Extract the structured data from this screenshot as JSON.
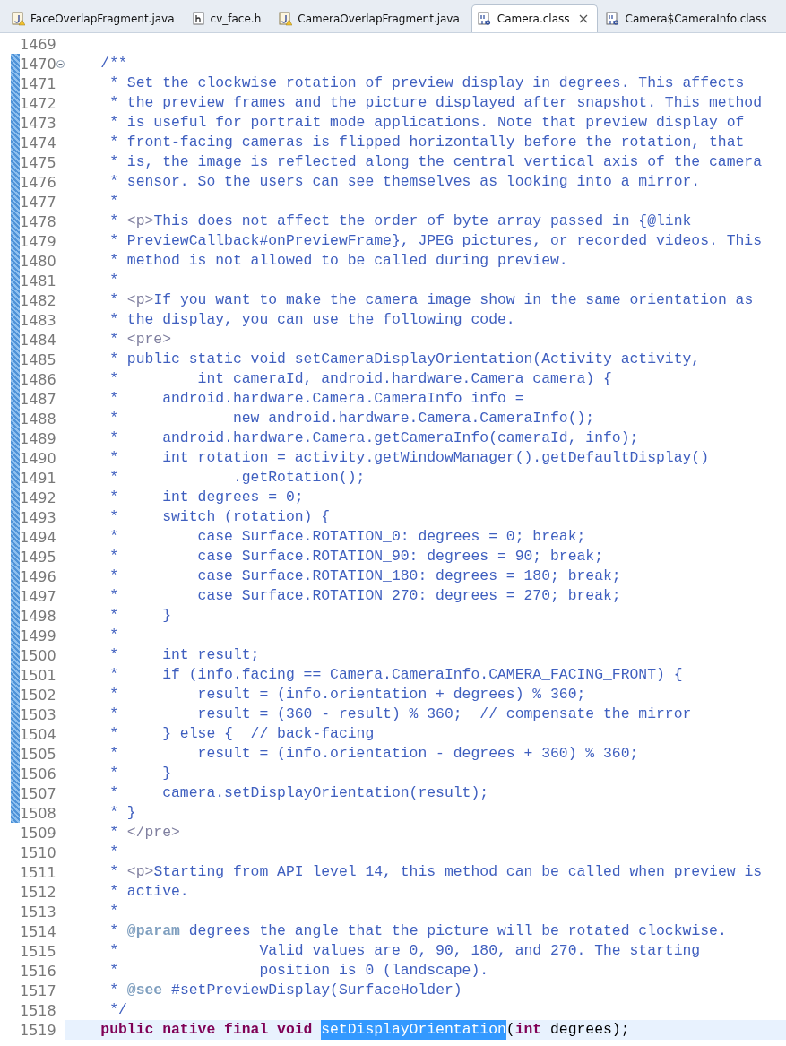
{
  "tabs": [
    {
      "label": "FaceOverlapFragment.java",
      "kind": "java",
      "selected": false
    },
    {
      "label": "cv_face.h",
      "kind": "header",
      "selected": false
    },
    {
      "label": "CameraOverlapFragment.java",
      "kind": "java",
      "selected": false
    },
    {
      "label": "Camera.class",
      "kind": "class",
      "selected": true
    },
    {
      "label": "Camera$CameraInfo.class",
      "kind": "class",
      "selected": false
    }
  ],
  "lines": [
    {
      "number": "1469",
      "marked": false,
      "fold": false,
      "current": false
    },
    {
      "number": "1470",
      "marked": true,
      "fold": true,
      "current": false,
      "segments": [
        {
          "kind": "comment",
          "text": "    /**"
        }
      ]
    },
    {
      "number": "1471",
      "marked": true,
      "fold": false,
      "current": false,
      "segments": [
        {
          "kind": "comment",
          "text": "     * Set the clockwise rotation of preview display in degrees. This affects"
        }
      ]
    },
    {
      "number": "1472",
      "marked": true,
      "fold": false,
      "current": false,
      "segments": [
        {
          "kind": "comment",
          "text": "     * the preview frames and the picture displayed after snapshot. This method"
        }
      ]
    },
    {
      "number": "1473",
      "marked": true,
      "fold": false,
      "current": false,
      "segments": [
        {
          "kind": "comment",
          "text": "     * is useful for portrait mode applications. Note that preview display of"
        }
      ]
    },
    {
      "number": "1474",
      "marked": true,
      "fold": false,
      "current": false,
      "segments": [
        {
          "kind": "comment",
          "text": "     * front-facing cameras is flipped horizontally before the rotation, that"
        }
      ]
    },
    {
      "number": "1475",
      "marked": true,
      "fold": false,
      "current": false,
      "segments": [
        {
          "kind": "comment",
          "text": "     * is, the image is reflected along the central vertical axis of the camera"
        }
      ]
    },
    {
      "number": "1476",
      "marked": true,
      "fold": false,
      "current": false,
      "segments": [
        {
          "kind": "comment",
          "text": "     * sensor. So the users can see themselves as looking into a mirror."
        }
      ]
    },
    {
      "number": "1477",
      "marked": true,
      "fold": false,
      "current": false,
      "segments": [
        {
          "kind": "comment",
          "text": "     *"
        }
      ]
    },
    {
      "number": "1478",
      "marked": true,
      "fold": false,
      "current": false,
      "segments": [
        {
          "kind": "comment",
          "text": "     * "
        },
        {
          "kind": "html",
          "text": "<p>"
        },
        {
          "kind": "comment",
          "text": "This does not affect the order of byte array passed in {@link"
        }
      ]
    },
    {
      "number": "1479",
      "marked": true,
      "fold": false,
      "current": false,
      "segments": [
        {
          "kind": "comment",
          "text": "     * PreviewCallback#onPreviewFrame}, JPEG pictures, or recorded videos. This"
        }
      ]
    },
    {
      "number": "1480",
      "marked": true,
      "fold": false,
      "current": false,
      "segments": [
        {
          "kind": "comment",
          "text": "     * method is not allowed to be called during preview."
        }
      ]
    },
    {
      "number": "1481",
      "marked": true,
      "fold": false,
      "current": false,
      "segments": [
        {
          "kind": "comment",
          "text": "     *"
        }
      ]
    },
    {
      "number": "1482",
      "marked": true,
      "fold": false,
      "current": false,
      "segments": [
        {
          "kind": "comment",
          "text": "     * "
        },
        {
          "kind": "html",
          "text": "<p>"
        },
        {
          "kind": "comment",
          "text": "If you want to make the camera image show in the same orientation as"
        }
      ]
    },
    {
      "number": "1483",
      "marked": true,
      "fold": false,
      "current": false,
      "segments": [
        {
          "kind": "comment",
          "text": "     * the display, you can use the following code."
        }
      ]
    },
    {
      "number": "1484",
      "marked": true,
      "fold": false,
      "current": false,
      "segments": [
        {
          "kind": "comment",
          "text": "     * "
        },
        {
          "kind": "html",
          "text": "<pre>"
        }
      ]
    },
    {
      "number": "1485",
      "marked": true,
      "fold": false,
      "current": false,
      "segments": [
        {
          "kind": "comment",
          "text": "     * public static void setCameraDisplayOrientation(Activity activity,"
        }
      ]
    },
    {
      "number": "1486",
      "marked": true,
      "fold": false,
      "current": false,
      "segments": [
        {
          "kind": "comment",
          "text": "     *         int cameraId, android.hardware.Camera camera) {"
        }
      ]
    },
    {
      "number": "1487",
      "marked": true,
      "fold": false,
      "current": false,
      "segments": [
        {
          "kind": "comment",
          "text": "     *     android.hardware.Camera.CameraInfo info ="
        }
      ]
    },
    {
      "number": "1488",
      "marked": true,
      "fold": false,
      "current": false,
      "segments": [
        {
          "kind": "comment",
          "text": "     *             new android.hardware.Camera.CameraInfo();"
        }
      ]
    },
    {
      "number": "1489",
      "marked": true,
      "fold": false,
      "current": false,
      "segments": [
        {
          "kind": "comment",
          "text": "     *     android.hardware.Camera.getCameraInfo(cameraId, info);"
        }
      ]
    },
    {
      "number": "1490",
      "marked": true,
      "fold": false,
      "current": false,
      "segments": [
        {
          "kind": "comment",
          "text": "     *     int rotation = activity.getWindowManager().getDefaultDisplay()"
        }
      ]
    },
    {
      "number": "1491",
      "marked": true,
      "fold": false,
      "current": false,
      "segments": [
        {
          "kind": "comment",
          "text": "     *             .getRotation();"
        }
      ]
    },
    {
      "number": "1492",
      "marked": true,
      "fold": false,
      "current": false,
      "segments": [
        {
          "kind": "comment",
          "text": "     *     int degrees = 0;"
        }
      ]
    },
    {
      "number": "1493",
      "marked": true,
      "fold": false,
      "current": false,
      "segments": [
        {
          "kind": "comment",
          "text": "     *     switch (rotation) {"
        }
      ]
    },
    {
      "number": "1494",
      "marked": true,
      "fold": false,
      "current": false,
      "segments": [
        {
          "kind": "comment",
          "text": "     *         case Surface.ROTATION_0: degrees = 0; break;"
        }
      ]
    },
    {
      "number": "1495",
      "marked": true,
      "fold": false,
      "current": false,
      "segments": [
        {
          "kind": "comment",
          "text": "     *         case Surface.ROTATION_90: degrees = 90; break;"
        }
      ]
    },
    {
      "number": "1496",
      "marked": true,
      "fold": false,
      "current": false,
      "segments": [
        {
          "kind": "comment",
          "text": "     *         case Surface.ROTATION_180: degrees = 180; break;"
        }
      ]
    },
    {
      "number": "1497",
      "marked": true,
      "fold": false,
      "current": false,
      "segments": [
        {
          "kind": "comment",
          "text": "     *         case Surface.ROTATION_270: degrees = 270; break;"
        }
      ]
    },
    {
      "number": "1498",
      "marked": true,
      "fold": false,
      "current": false,
      "segments": [
        {
          "kind": "comment",
          "text": "     *     }"
        }
      ]
    },
    {
      "number": "1499",
      "marked": true,
      "fold": false,
      "current": false,
      "segments": [
        {
          "kind": "comment",
          "text": "     *"
        }
      ]
    },
    {
      "number": "1500",
      "marked": true,
      "fold": false,
      "current": false,
      "segments": [
        {
          "kind": "comment",
          "text": "     *     int result;"
        }
      ]
    },
    {
      "number": "1501",
      "marked": true,
      "fold": false,
      "current": false,
      "segments": [
        {
          "kind": "comment",
          "text": "     *     if (info.facing == Camera.CameraInfo.CAMERA_FACING_FRONT) {"
        }
      ]
    },
    {
      "number": "1502",
      "marked": true,
      "fold": false,
      "current": false,
      "segments": [
        {
          "kind": "comment",
          "text": "     *         result = (info.orientation + degrees) % 360;"
        }
      ]
    },
    {
      "number": "1503",
      "marked": true,
      "fold": false,
      "current": false,
      "segments": [
        {
          "kind": "comment",
          "text": "     *         result = (360 - result) % 360;  // compensate the mirror"
        }
      ]
    },
    {
      "number": "1504",
      "marked": true,
      "fold": false,
      "current": false,
      "segments": [
        {
          "kind": "comment",
          "text": "     *     } else {  // back-facing"
        }
      ]
    },
    {
      "number": "1505",
      "marked": true,
      "fold": false,
      "current": false,
      "segments": [
        {
          "kind": "comment",
          "text": "     *         result = (info.orientation - degrees + 360) % 360;"
        }
      ]
    },
    {
      "number": "1506",
      "marked": true,
      "fold": false,
      "current": false,
      "segments": [
        {
          "kind": "comment",
          "text": "     *     }"
        }
      ]
    },
    {
      "number": "1507",
      "marked": true,
      "fold": false,
      "current": false,
      "segments": [
        {
          "kind": "comment",
          "text": "     *     camera.setDisplayOrientation(result);"
        }
      ]
    },
    {
      "number": "1508",
      "marked": true,
      "fold": false,
      "current": false,
      "segments": [
        {
          "kind": "comment",
          "text": "     * }"
        }
      ]
    },
    {
      "number": "1509",
      "marked": false,
      "fold": false,
      "current": false,
      "segments": [
        {
          "kind": "comment",
          "text": "     * "
        },
        {
          "kind": "html",
          "text": "</pre>"
        }
      ]
    },
    {
      "number": "1510",
      "marked": false,
      "fold": false,
      "current": false,
      "segments": [
        {
          "kind": "comment",
          "text": "     *"
        }
      ]
    },
    {
      "number": "1511",
      "marked": false,
      "fold": false,
      "current": false,
      "segments": [
        {
          "kind": "comment",
          "text": "     * "
        },
        {
          "kind": "html",
          "text": "<p>"
        },
        {
          "kind": "comment",
          "text": "Starting from API level 14, this method can be called when preview is"
        }
      ]
    },
    {
      "number": "1512",
      "marked": false,
      "fold": false,
      "current": false,
      "segments": [
        {
          "kind": "comment",
          "text": "     * active."
        }
      ]
    },
    {
      "number": "1513",
      "marked": false,
      "fold": false,
      "current": false,
      "segments": [
        {
          "kind": "comment",
          "text": "     *"
        }
      ]
    },
    {
      "number": "1514",
      "marked": false,
      "fold": false,
      "current": false,
      "segments": [
        {
          "kind": "comment",
          "text": "     * "
        },
        {
          "kind": "doctag",
          "text": "@param"
        },
        {
          "kind": "comment",
          "text": " degrees the angle that the picture will be rotated clockwise."
        }
      ]
    },
    {
      "number": "1515",
      "marked": false,
      "fold": false,
      "current": false,
      "segments": [
        {
          "kind": "comment",
          "text": "     *                Valid values are 0, 90, 180, and 270. The starting"
        }
      ]
    },
    {
      "number": "1516",
      "marked": false,
      "fold": false,
      "current": false,
      "segments": [
        {
          "kind": "comment",
          "text": "     *                position is 0 (landscape)."
        }
      ]
    },
    {
      "number": "1517",
      "marked": false,
      "fold": false,
      "current": false,
      "segments": [
        {
          "kind": "comment",
          "text": "     * "
        },
        {
          "kind": "doctag",
          "text": "@see"
        },
        {
          "kind": "comment",
          "text": " #setPreviewDisplay(SurfaceHolder)"
        }
      ]
    },
    {
      "number": "1518",
      "marked": false,
      "fold": false,
      "current": false,
      "segments": [
        {
          "kind": "comment",
          "text": "     */"
        }
      ]
    },
    {
      "number": "1519",
      "marked": false,
      "fold": false,
      "current": true,
      "segments": [
        {
          "kind": "keyword",
          "text": "    public native final void "
        },
        {
          "kind": "selection",
          "text": "setDisplayOrientation"
        },
        {
          "kind": "code",
          "text": "("
        },
        {
          "kind": "keyword",
          "text": "int"
        },
        {
          "kind": "code",
          "text": " degrees);"
        }
      ]
    }
  ]
}
